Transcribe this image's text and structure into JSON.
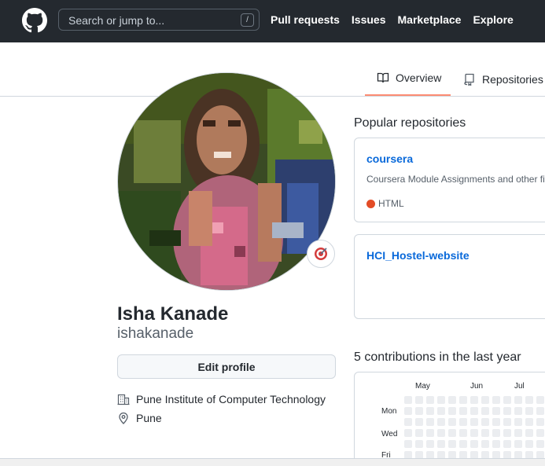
{
  "header": {
    "search_placeholder": "Search or jump to...",
    "search_shortcut": "/",
    "nav": [
      "Pull requests",
      "Issues",
      "Marketplace",
      "Explore"
    ]
  },
  "tabs": {
    "overview": "Overview",
    "repositories": "Repositories"
  },
  "profile": {
    "name": "Isha Kanade",
    "username": "ishakanade",
    "edit_label": "Edit profile",
    "organization": "Pune Institute of Computer Technology",
    "location": "Pune"
  },
  "popular": {
    "title": "Popular repositories",
    "repos": [
      {
        "name": "coursera",
        "description": "Coursera Module Assignments and other files",
        "language": "HTML",
        "language_color": "#e34c26"
      },
      {
        "name": "HCI_Hostel-website"
      }
    ]
  },
  "contributions": {
    "title": "5 contributions in the last year",
    "months": [
      "May",
      "Jun",
      "Jul"
    ],
    "days": [
      "Mon",
      "Wed",
      "Fri"
    ]
  },
  "colors": {
    "header_bg": "#24292f",
    "link": "#0969da",
    "tab_underline": "#fd8c73",
    "empty_cell": "#ebedf0"
  }
}
